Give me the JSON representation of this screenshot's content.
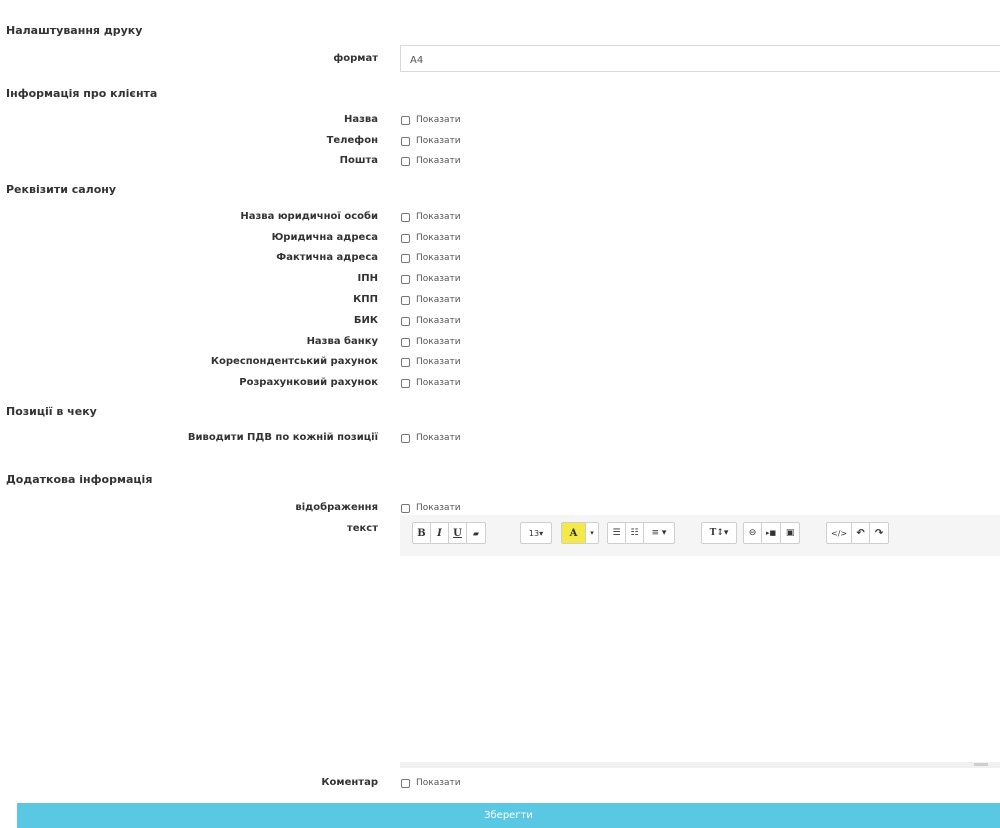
{
  "sections": {
    "print": "Налаштування друку",
    "client": "Інформація про клієнта",
    "salon": "Реквізити салону",
    "positions": "Позиції в чеку",
    "extra": "Додаткова інформація"
  },
  "print": {
    "format_label": "формат",
    "format_value": "A4"
  },
  "checkbox_label": "Показати",
  "client_fields": [
    "Назва",
    "Телефон",
    "Пошта"
  ],
  "salon_fields": [
    "Назва юридичної особи",
    "Юридична адреса",
    "Фактична адреса",
    "ІПН",
    "КПП",
    "БИК",
    "Назва банку",
    "Кореспондентський рахунок",
    "Розрахунковий рахунок"
  ],
  "positions_field": "Виводити ПДВ по кожній позиції",
  "extra": {
    "display_label": "відображення",
    "text_label": "текст"
  },
  "toolbar": {
    "bold": "B",
    "italic": "I",
    "underline": "U",
    "eraser": "▰",
    "font_size": "13▾",
    "color": "A",
    "color_caret": "▾",
    "ul": "☰",
    "ol": "☷",
    "align": "≡ ▾",
    "style": "T↕▾",
    "link": "⊖",
    "video": "▸■",
    "picture": "▣",
    "code": "</>",
    "undo": "↶",
    "redo": "↷",
    "color_highlight": "#f5e94a"
  },
  "comment_label": "Коментар",
  "save_label": "Зберегти",
  "colors": {
    "accent": "#5bc8e3"
  }
}
